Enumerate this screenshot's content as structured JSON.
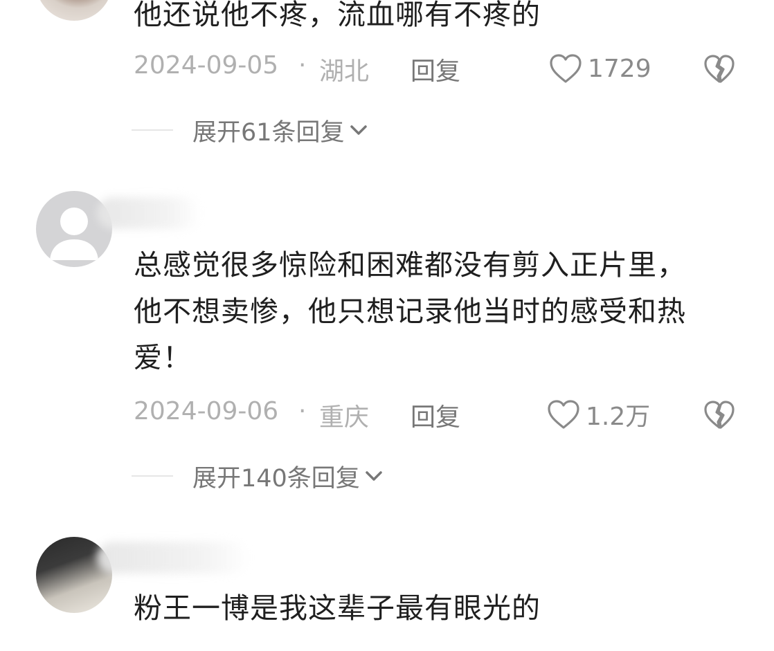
{
  "comments": [
    {
      "text": "他还说他不疼，流血哪有不疼的",
      "date": "2024-09-05",
      "separator": "·",
      "location": "湖北",
      "reply_label": "回复",
      "likes": "1729",
      "expand_label": "展开61条回复"
    },
    {
      "text": "总感觉很多惊险和困难都没有剪入正片里，\n他不想卖惨，他只想记录他当时的感受和热\n爱！",
      "date": "2024-09-06",
      "separator": "·",
      "location": "重庆",
      "reply_label": "回复",
      "likes": "1.2万",
      "expand_label": "展开140条回复"
    },
    {
      "text": "粉王一博是我这辈子最有眼光的"
    }
  ],
  "icons": {
    "like": "heart-outline-icon",
    "dislike": "broken-heart-icon",
    "expand": "chevron-down-icon"
  },
  "colors": {
    "text": "#1f1f1f",
    "meta": "#b0b0b0",
    "action": "#777777",
    "icon": "#8a8a8a"
  }
}
